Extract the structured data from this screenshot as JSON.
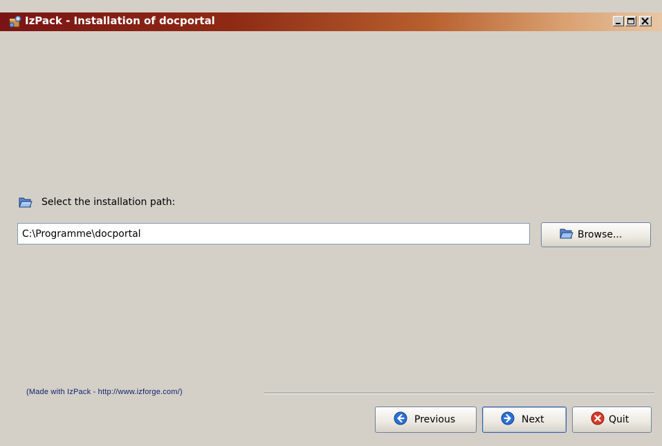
{
  "window": {
    "title": "IzPack - Installation of docportal",
    "app_icon": "installer-icon",
    "controls": [
      "minimize-icon",
      "maximize-icon",
      "close-icon"
    ]
  },
  "path_panel": {
    "label": "Select the installation path:",
    "label_icon": "open-folder-icon",
    "path_value": "C:\\Programme\\docportal",
    "browse_label": "Browse...",
    "browse_icon": "open-folder-icon"
  },
  "footer": {
    "made_with": "(Made with IzPack - http://www.izforge.com/)",
    "previous_label": "Previous",
    "previous_icon": "arrow-left-icon",
    "next_label": "Next",
    "next_icon": "arrow-right-icon",
    "quit_label": "Quit",
    "quit_icon": "cancel-icon"
  },
  "colors": {
    "titlebar_start": "#7a1414",
    "titlebar_end": "#e8c6a4",
    "background": "#d4d0c8",
    "nav_icon_blue": "#2a6fd6",
    "quit_icon_red": "#d83a2a",
    "link_text": "#0a1f6e"
  }
}
